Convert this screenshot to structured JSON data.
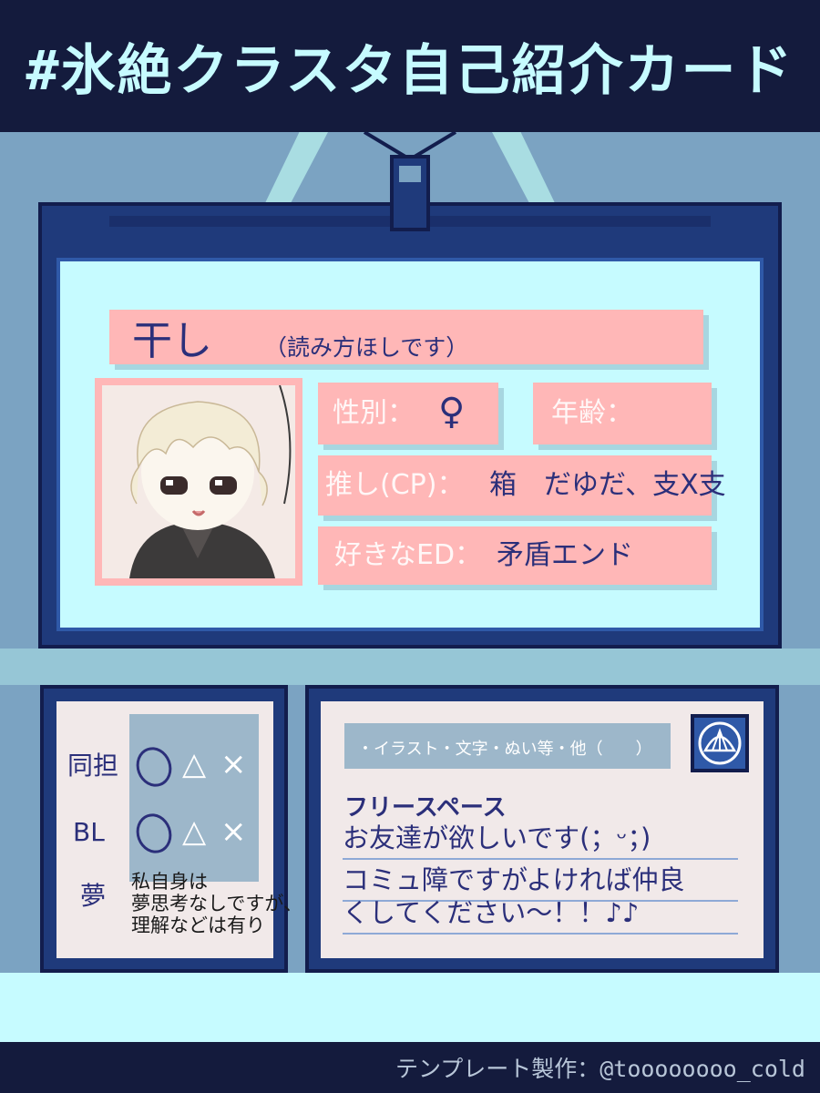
{
  "header": {
    "title": "#氷絶クラスタ自己紹介カード"
  },
  "profile": {
    "name": "干し",
    "reading": "（読み方ほしです）",
    "gender_label": "性別：",
    "gender_value": "♀",
    "age_label": "年齢：",
    "age_value": "",
    "oshi_label": "推し(CP)：",
    "oshi_value": "箱　だゆだ、支X支",
    "ed_label": "好きなED：",
    "ed_value": "矛盾エンド"
  },
  "preferences": {
    "rows": [
      {
        "label": "同担",
        "options": [
          "△",
          "×"
        ]
      },
      {
        "label": "BL",
        "options": [
          "△",
          "×"
        ]
      },
      {
        "label": "夢",
        "options": []
      }
    ],
    "note_lines": [
      "私自身は",
      "夢思考なしですが、",
      "理解などは有り"
    ]
  },
  "free_space": {
    "tag": "・イラスト・文字・ぬい等・他（　　）",
    "heading": "フリースペース",
    "lines": [
      "お友達が欲しいです(；ᵕ；)",
      "コミュ障ですがよければ仲良",
      "くしてください〜！！♪♪"
    ]
  },
  "footer": {
    "credit": "テンプレート製作：@toooooooo_cold"
  },
  "colors": {
    "background": "#7ba3c2",
    "header": "#141b3d",
    "card_frame": "#1f3a7b",
    "card_face": "#c6fbff",
    "label_pink": "#ffb7b7",
    "ink": "#2b2f7a"
  }
}
